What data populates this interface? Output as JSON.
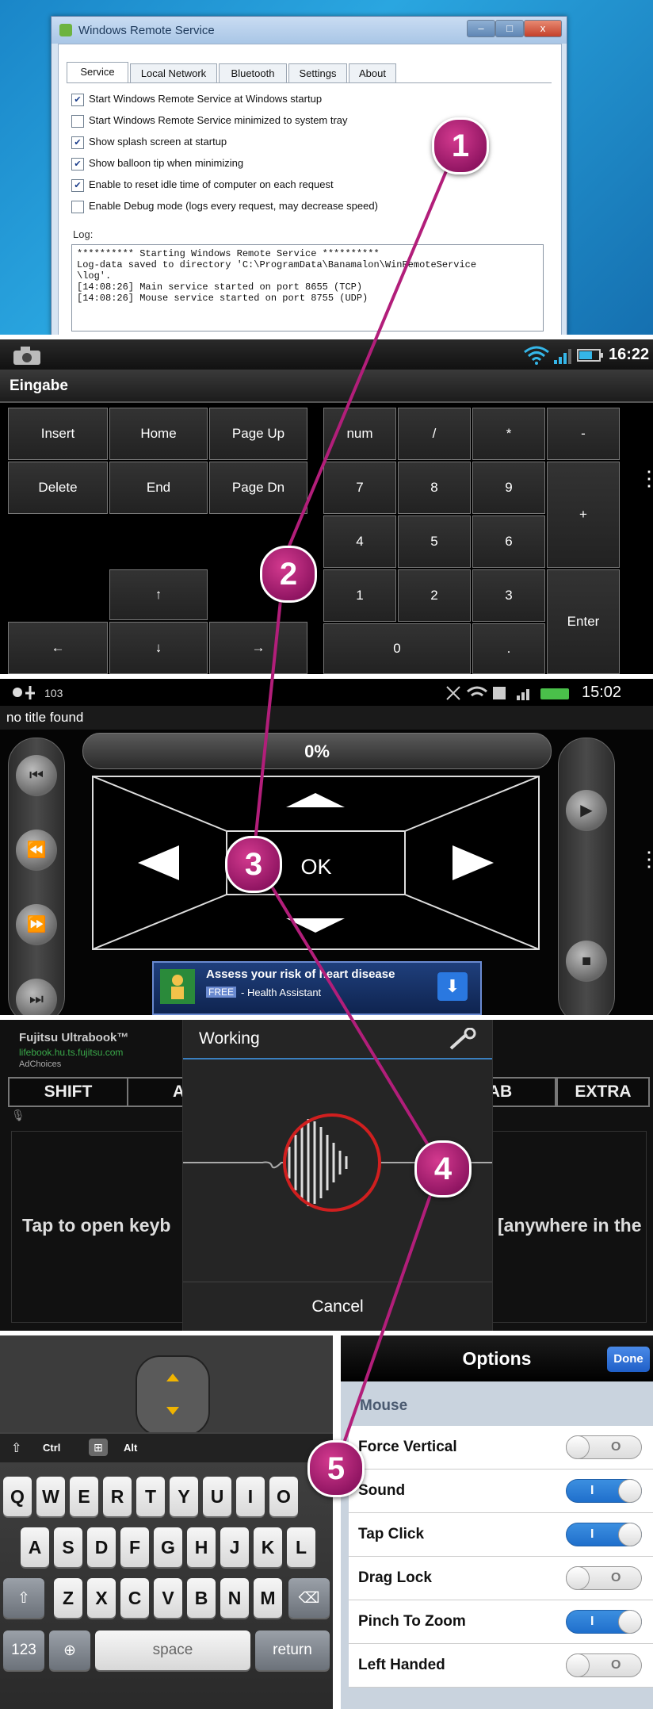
{
  "colors": {
    "badge": "#b21e7a",
    "windows_blue": "#1a86c8",
    "toggle_on": "#2a7fd8",
    "ios_done": "#2a6fd6"
  },
  "panel1": {
    "window_title": "Windows Remote Service",
    "window_controls": {
      "minimize": "–",
      "maximize": "□",
      "close": "x"
    },
    "tabs": [
      "Service",
      "Local Network",
      "Bluetooth",
      "Settings",
      "About"
    ],
    "checkboxes": [
      {
        "label": "Start Windows Remote Service at Windows startup",
        "checked": true
      },
      {
        "label": "Start Windows Remote Service minimized to system tray",
        "checked": false
      },
      {
        "label": "Show splash screen at startup",
        "checked": true
      },
      {
        "label": "Show balloon tip when minimizing",
        "checked": true
      },
      {
        "label": "Enable to reset idle time of computer on each request",
        "checked": true
      },
      {
        "label": "Enable Debug mode (logs every request, may decrease speed)",
        "checked": false
      }
    ],
    "log_label": "Log:",
    "log_lines": [
      "********** Starting Windows Remote Service **********",
      "Log-data saved to directory 'C:\\ProgramData\\Banamalon\\WinRemoteService",
      "\\log'.",
      "[14:08:26] Main service started on port 8655 (TCP)",
      "[14:08:26] Mouse service started on port 8755 (UDP)"
    ]
  },
  "panel2": {
    "status_time": "16:22",
    "header": "Eingabe",
    "keys": {
      "insert": "Insert",
      "home": "Home",
      "page_up": "Page Up",
      "delete": "Delete",
      "end": "End",
      "page_dn": "Page Dn",
      "up": "↑",
      "left": "←",
      "down": "↓",
      "right": "→"
    },
    "numpad": {
      "num": "num",
      "slash": "/",
      "star": "*",
      "minus": "-",
      "n7": "7",
      "n8": "8",
      "n9": "9",
      "plus": "+",
      "n4": "4",
      "n5": "5",
      "n6": "6",
      "n1": "1",
      "n2": "2",
      "n3": "3",
      "enter": "Enter",
      "n0": "0",
      "dot": "."
    }
  },
  "panel3": {
    "status_time": "15:02",
    "title": "no title found",
    "progress": "0%",
    "ok": "OK",
    "ad_title": "Assess your risk of heart disease",
    "ad_free": "FREE",
    "ad_sub": "- Health Assistant",
    "icons": [
      "skip-back-icon",
      "rewind-icon",
      "fast-forward-icon",
      "skip-forward-icon",
      "play-icon",
      "stop-icon"
    ]
  },
  "panel4": {
    "ad_brand": "Fujitsu Ultrabook™",
    "ad_url": "lifebook.hu.ts.fujitsu.com",
    "ad_choices": "AdChoices",
    "keys": [
      "SHIFT",
      "AL",
      "AB",
      "EXTRA"
    ],
    "dialog_title": "Working",
    "tap_left": "Tap to open keyb",
    "tap_right": "[anywhere in the",
    "cancel": "Cancel"
  },
  "panel5": {
    "mod_keys": {
      "ctrl": "Ctrl",
      "alt": "Alt"
    },
    "row1": [
      "Q",
      "W",
      "E",
      "R",
      "T",
      "Y",
      "U",
      "I",
      "O"
    ],
    "row2": [
      "A",
      "S",
      "D",
      "F",
      "G",
      "H",
      "J",
      "K",
      "L"
    ],
    "row3": [
      "Z",
      "X",
      "C",
      "V",
      "B",
      "N",
      "M"
    ],
    "bottom": {
      "numbers": "123",
      "space": "space",
      "return": "return"
    },
    "options_title": "Options",
    "done": "Done",
    "section": "Mouse",
    "options": [
      {
        "label": "Force Vertical",
        "on": false
      },
      {
        "label": "Sound",
        "on": true
      },
      {
        "label": "Tap Click",
        "on": true
      },
      {
        "label": "Drag Lock",
        "on": false
      },
      {
        "label": "Pinch To Zoom",
        "on": true
      },
      {
        "label": "Left Handed",
        "on": false
      }
    ],
    "toggle_on_mark": "I",
    "toggle_off_mark": "O"
  },
  "badges": [
    "1",
    "2",
    "3",
    "4",
    "5"
  ]
}
